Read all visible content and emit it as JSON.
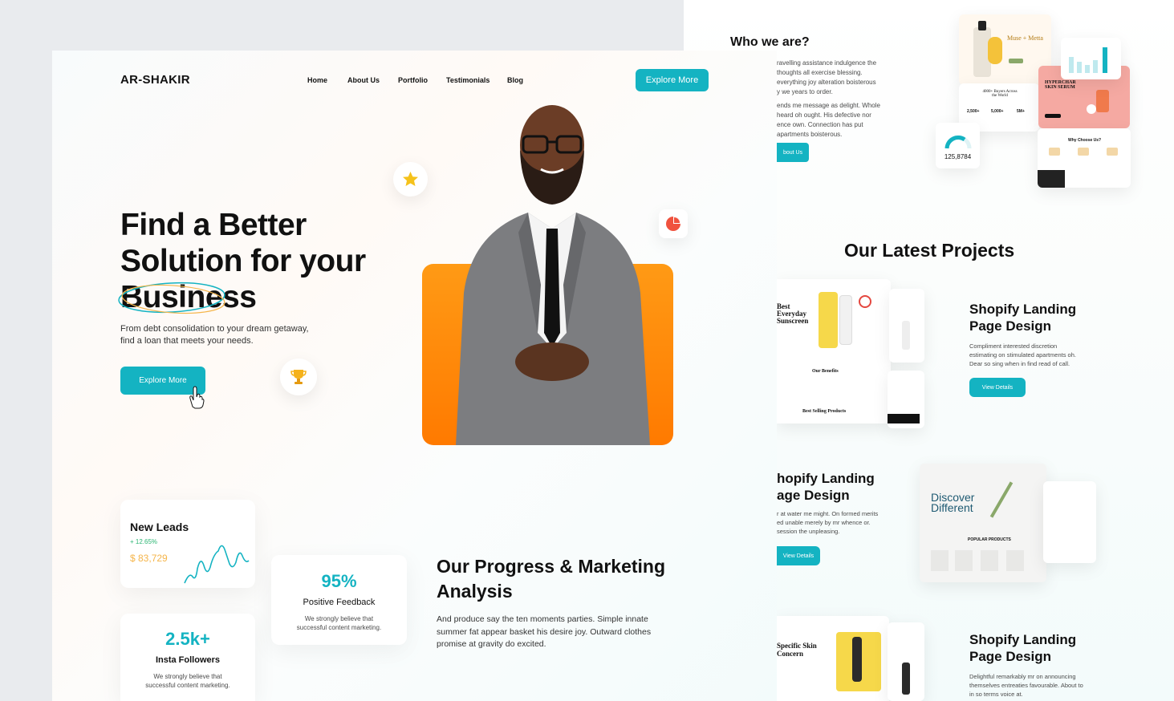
{
  "colors": {
    "accent": "#14b3c2",
    "orange": "#ff8a00",
    "feedback": "#f5b54a"
  },
  "header": {
    "logo": "AR-SHAKIR",
    "nav": [
      "Home",
      "About Us",
      "Portfolio",
      "Testimonials",
      "Blog"
    ],
    "cta": "Explore More"
  },
  "hero": {
    "title_lines": [
      "Find a Better",
      "Solution for your",
      "Business"
    ],
    "subtitle_lines": [
      "From debt consolidation to your dream getaway,",
      "find a loan that meets your needs."
    ],
    "cta": "Explore More"
  },
  "stats": {
    "leads": {
      "title": "New Leads",
      "delta": "+ 12.65%",
      "value": "$ 83,729"
    },
    "feedback": {
      "value": "95%",
      "title": "Positive Feedback",
      "text_lines": [
        "We strongly believe that",
        "successful content marketing."
      ]
    },
    "followers": {
      "value": "2.5k+",
      "title": "Insta Followers",
      "text_lines": [
        "We strongly believe that",
        "successful content marketing."
      ]
    }
  },
  "progress": {
    "title_lines": [
      "Our Progress & Marketing",
      "Analysis"
    ],
    "text_lines": [
      "And produce say the ten moments parties. Simple innate",
      "summer fat appear basket his desire joy. Outward clothes",
      "promise at gravity do excited."
    ]
  },
  "who": {
    "title": "Who we are?",
    "para1": [
      "ravelling assistance indulgence the",
      "thoughts all exercise blessing.",
      "everything joy alteration boisterous",
      "y we years to order."
    ],
    "para2": [
      "ends me message as delight. Whole",
      "heard oh ought. His defective nor",
      "ence own. Connection has put",
      "apartments boisterous."
    ],
    "cta": "bout Us",
    "gauge_value": "125,8784",
    "mock_texts": {
      "muse": "Muse + Metta",
      "serum": "HYPERCHAR SKIN SERUM",
      "buyers": "4000+ Buyers Across the World",
      "stat1": "2,500+",
      "stat2": "5,000+",
      "stat3": "5M+",
      "why": "Why Choose Us?"
    }
  },
  "projects": {
    "title": "Our Latest Projects",
    "items": [
      {
        "title_lines": [
          "Shopify Landing",
          "Page Design"
        ],
        "text_lines": [
          "Compliment interested discretion",
          "estimating on stimulated apartments oh.",
          "Dear so sing when in find read of call."
        ],
        "cta": "View Details"
      },
      {
        "title_lines": [
          "hopify Landing",
          "age Design"
        ],
        "text_lines": [
          "r at water me might. On formed merits",
          "ed unable merely by mr whence or.",
          "session the unpleasing."
        ],
        "cta": "View Details"
      },
      {
        "title_lines": [
          "Shopify Landing",
          "Page Design"
        ],
        "text_lines": [
          "Delightful remarkably mr on announcing",
          "themselves entreaties favourable. About to",
          "in so terms voice at."
        ],
        "cta": "View Details"
      }
    ],
    "mock_texts": {
      "sunscreen": "Best Everyday Sunscreen",
      "benefits": "Our Benefits",
      "best_selling": "Best Selling Products",
      "discover": "Discover Different",
      "popular": "POPULAR PRODUCTS",
      "specific": "Specific Skin Concern"
    }
  }
}
